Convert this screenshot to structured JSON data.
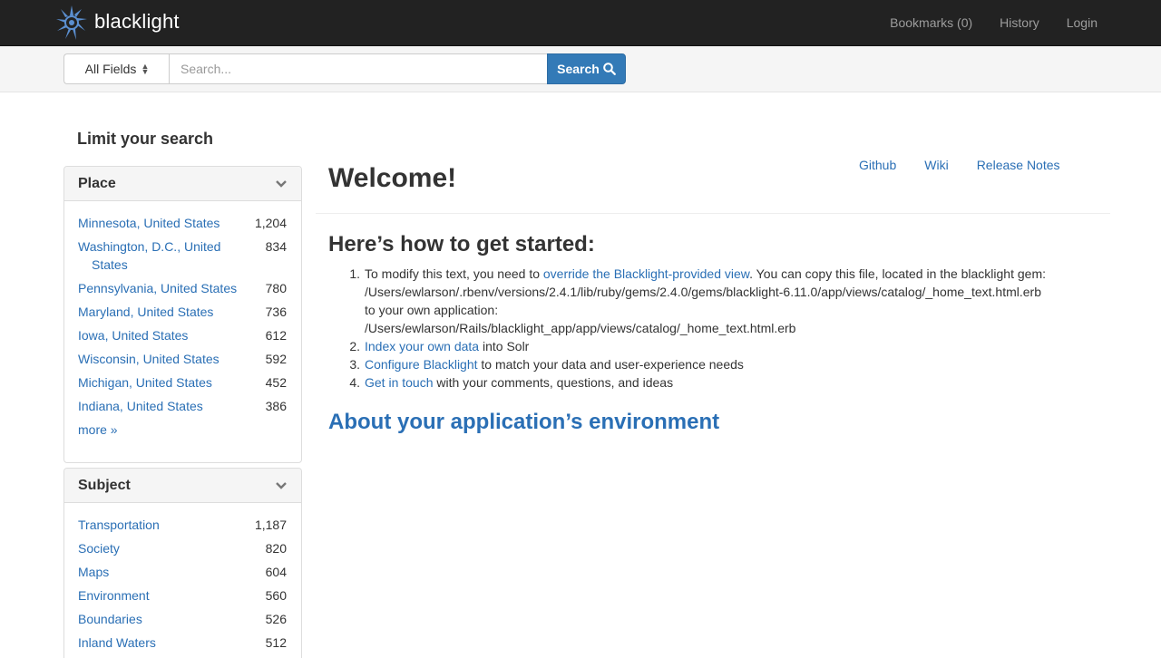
{
  "nav": {
    "brand": "blacklight",
    "links": [
      "Bookmarks (0)",
      "History",
      "Login"
    ]
  },
  "search": {
    "field_select": "All Fields",
    "placeholder": "Search...",
    "button": "Search"
  },
  "sidebar": {
    "title": "Limit your search",
    "facets": [
      {
        "title": "Place",
        "items": [
          {
            "label": "Minnesota, United States",
            "count": "1,204"
          },
          {
            "label": "Washington, D.C., United States",
            "count": "834"
          },
          {
            "label": "Pennsylvania, United States",
            "count": "780"
          },
          {
            "label": "Maryland, United States",
            "count": "736"
          },
          {
            "label": "Iowa, United States",
            "count": "612"
          },
          {
            "label": "Wisconsin, United States",
            "count": "592"
          },
          {
            "label": "Michigan, United States",
            "count": "452"
          },
          {
            "label": "Indiana, United States",
            "count": "386"
          }
        ],
        "more": "more »"
      },
      {
        "title": "Subject",
        "items": [
          {
            "label": "Transportation",
            "count": "1,187"
          },
          {
            "label": "Society",
            "count": "820"
          },
          {
            "label": "Maps",
            "count": "604"
          },
          {
            "label": "Environment",
            "count": "560"
          },
          {
            "label": "Boundaries",
            "count": "526"
          },
          {
            "label": "Inland Waters",
            "count": "512"
          }
        ]
      }
    ]
  },
  "main": {
    "top_links": [
      "Github",
      "Wiki",
      "Release Notes"
    ],
    "welcome": "Welcome!",
    "started_heading": "Here’s how to get started:",
    "step1": {
      "pre": "To modify this text, you need to ",
      "link": "override the Blacklight-provided view",
      "post": ". You can copy this file, located in the blacklight gem:",
      "path1": "/Users/ewlarson/.rbenv/versions/2.4.1/lib/ruby/gems/2.4.0/gems/blacklight-6.11.0/app/views/catalog/_home_text.html.erb",
      "mid": "to your own application:",
      "path2": "/Users/ewlarson/Rails/blacklight_app/app/views/catalog/_home_text.html.erb"
    },
    "step2": {
      "link": "Index your own data",
      "post": " into Solr"
    },
    "step3": {
      "link": "Configure Blacklight",
      "post": " to match your data and user-experience needs"
    },
    "step4": {
      "link": "Get in touch",
      "post": " with your comments, questions, and ideas"
    },
    "about": "About your application’s environment"
  }
}
